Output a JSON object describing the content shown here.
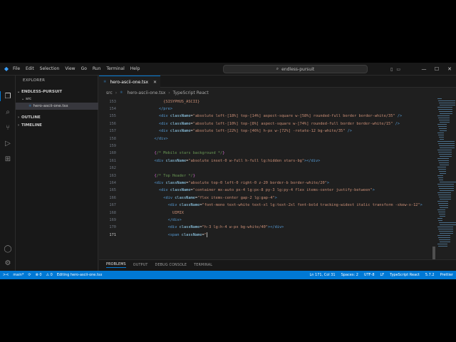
{
  "menu": [
    "File",
    "Edit",
    "Selection",
    "View",
    "Go",
    "Run",
    "Terminal",
    "Help"
  ],
  "search": {
    "label": "endless-pursuit"
  },
  "sidebar": {
    "title": "EXPLORER",
    "workspace": "ENDLESS-PURSUIT",
    "folder": "src",
    "file": "hero-ascii-one.tsx",
    "outline": "OUTLINE",
    "timeline": "TIMELINE"
  },
  "tab": {
    "label": "hero-ascii-one.tsx",
    "badge": "TSX"
  },
  "breadcrumb": {
    "folder": "src",
    "file": "hero-ascii-one.tsx",
    "symbol": "TypeScript React"
  },
  "editor_lines": [
    {
      "n": "153",
      "segs": [
        [
          "            ",
          "txt"
        ],
        [
          "{SISYPHUS_ASCII}",
          "str"
        ]
      ]
    },
    {
      "n": "154",
      "segs": [
        [
          "          ",
          "txt"
        ],
        [
          "</pre>",
          "tag"
        ]
      ]
    },
    {
      "n": "155",
      "segs": [
        [
          "          ",
          "txt"
        ],
        [
          "<div ",
          "tag"
        ],
        [
          "className",
          "attr"
        ],
        [
          "=",
          "txt"
        ],
        [
          "\"absolute left-[18%] top-[14%] aspect-square w-[58%] rounded-full border border-white/35\"",
          "str"
        ],
        [
          " />",
          "tag"
        ]
      ]
    },
    {
      "n": "156",
      "segs": [
        [
          "          ",
          "txt"
        ],
        [
          "<div ",
          "tag"
        ],
        [
          "className",
          "attr"
        ],
        [
          "=",
          "txt"
        ],
        [
          "\"absolute left-[10%] top-[8%] aspect-square w-[74%] rounded-full border border-white/15\"",
          "str"
        ],
        [
          " />",
          "tag"
        ]
      ]
    },
    {
      "n": "157",
      "segs": [
        [
          "          ",
          "txt"
        ],
        [
          "<div ",
          "tag"
        ],
        [
          "className",
          "attr"
        ],
        [
          "=",
          "txt"
        ],
        [
          "\"absolute left-[22%] top-[46%] h-px w-[72%] -rotate-12 bg-white/35\"",
          "str"
        ],
        [
          " />",
          "tag"
        ]
      ]
    },
    {
      "n": "158",
      "segs": [
        [
          "        ",
          "txt"
        ],
        [
          "</div>",
          "tag"
        ]
      ]
    },
    {
      "n": "159",
      "segs": []
    },
    {
      "n": "160",
      "segs": [
        [
          "        ",
          "txt"
        ],
        [
          "{",
          "brace"
        ],
        [
          "/* Mobile stars background */",
          "cmt"
        ],
        [
          "}",
          "brace"
        ]
      ]
    },
    {
      "n": "161",
      "segs": [
        [
          "        ",
          "txt"
        ],
        [
          "<div ",
          "tag"
        ],
        [
          "className",
          "attr"
        ],
        [
          "=",
          "txt"
        ],
        [
          "\"absolute inset-0 w-full h-full lg:hidden stars-bg\"",
          "str"
        ],
        [
          "></div>",
          "tag"
        ]
      ]
    },
    {
      "n": "162",
      "segs": []
    },
    {
      "n": "163",
      "segs": [
        [
          "        ",
          "txt"
        ],
        [
          "{",
          "brace"
        ],
        [
          "/* Top Header */",
          "cmt"
        ],
        [
          "}",
          "brace"
        ]
      ]
    },
    {
      "n": "164",
      "segs": [
        [
          "        ",
          "txt"
        ],
        [
          "<div ",
          "tag"
        ],
        [
          "className",
          "attr"
        ],
        [
          "=",
          "txt"
        ],
        [
          "\"absolute top-0 left-0 right-0 z-20 border-b border-white/20\"",
          "str"
        ],
        [
          ">",
          "tag"
        ]
      ]
    },
    {
      "n": "165",
      "segs": [
        [
          "          ",
          "txt"
        ],
        [
          "<div ",
          "tag"
        ],
        [
          "className",
          "attr"
        ],
        [
          "=",
          "txt"
        ],
        [
          "\"container mx-auto px-4 lg:px-8 py-3 lg:py-4 flex items-center justify-between\"",
          "str"
        ],
        [
          ">",
          "tag"
        ]
      ]
    },
    {
      "n": "166",
      "segs": [
        [
          "            ",
          "txt"
        ],
        [
          "<div ",
          "tag"
        ],
        [
          "className",
          "attr"
        ],
        [
          "=",
          "txt"
        ],
        [
          "\"flex items-center gap-2 lg:gap-4\"",
          "str"
        ],
        [
          ">",
          "tag"
        ]
      ]
    },
    {
      "n": "167",
      "segs": [
        [
          "              ",
          "txt"
        ],
        [
          "<div ",
          "tag"
        ],
        [
          "className",
          "attr"
        ],
        [
          "=",
          "txt"
        ],
        [
          "\"font-mono text-white text-xl lg:text-2xl font-bold tracking-widest italic transform -skew-x-12\"",
          "str"
        ],
        [
          ">",
          "tag"
        ]
      ]
    },
    {
      "n": "168",
      "segs": [
        [
          "                ",
          "txt"
        ],
        [
          "UIMIX",
          "str"
        ]
      ]
    },
    {
      "n": "169",
      "segs": [
        [
          "              ",
          "txt"
        ],
        [
          "</div>",
          "tag"
        ]
      ]
    },
    {
      "n": "170",
      "segs": [
        [
          "              ",
          "txt"
        ],
        [
          "<div ",
          "tag"
        ],
        [
          "className",
          "attr"
        ],
        [
          "=",
          "txt"
        ],
        [
          "\"h-3 lg:h-4 w-px bg-white/40\"",
          "str"
        ],
        [
          "></div>",
          "tag"
        ]
      ]
    },
    {
      "n": "171",
      "segs": [
        [
          "              ",
          "txt"
        ],
        [
          "<span ",
          "tag"
        ],
        [
          "className",
          "attr"
        ],
        [
          "=",
          "txt"
        ],
        [
          "\"",
          "str"
        ]
      ],
      "cursor": true
    }
  ],
  "panel_tabs": [
    "PROBLEMS",
    "OUTPUT",
    "DEBUG CONSOLE",
    "TERMINAL"
  ],
  "status": {
    "remote": "><",
    "branch": "main*",
    "sync": "⟳",
    "errors": "⊗ 0",
    "warnings": "⚠ 0",
    "editing": "Editing hero-ascii-one.tsx",
    "position": "Ln 171, Col 31",
    "spaces": "Spaces: 2",
    "encoding": "UTF-8",
    "eol": "LF",
    "language": "TypeScript React",
    "ts_version": "5.7.2",
    "prettier": "Prettier"
  },
  "colors": {
    "accent": "#0078d4",
    "editor_bg": "#1f1f1f",
    "chrome_bg": "#181818"
  }
}
